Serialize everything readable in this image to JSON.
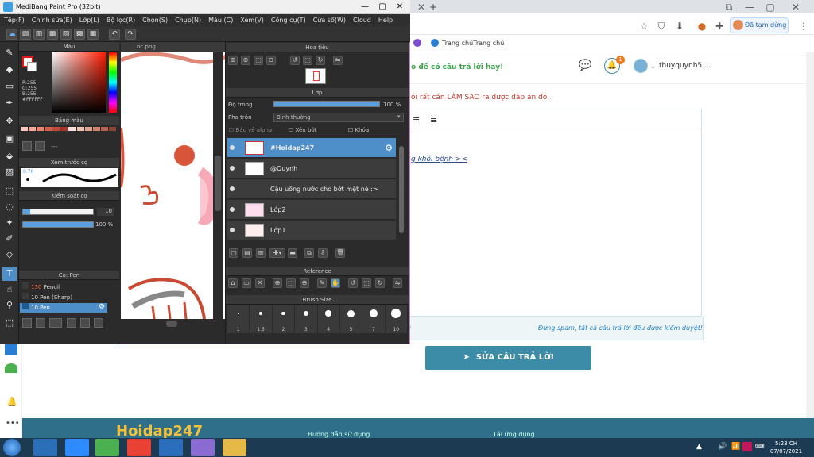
{
  "browser": {
    "bookmark": "Trang chủTrang chủ",
    "profile_label": "Đã tạm dừng",
    "login_prompt": "o để có câu trả lời hay!",
    "user_name": "thuyquynh5 ...",
    "notif_count": "1",
    "question_text": "ỏi rất cần LÀM SAO ra được đáp án đó.",
    "editor_text": "g khỏi bệnh ><",
    "warning": "Đừng spam, tất cả câu trả lời đều được kiểm duyệt!",
    "submit_label": "SỬA CÂU TRẢ LỜI",
    "footer_logo": "Hoidap247",
    "footer_link1": "Hướng dẫn sử dụng",
    "footer_link2": "Tải ứng dụng"
  },
  "app": {
    "title": "MediBang Paint Pro (32bit)",
    "menu": [
      "Tệp(F)",
      "Chỉnh sửa(E)",
      "Lớp(L)",
      "Bộ lọc(R)",
      "Chọn(S)",
      "Chụp(N)",
      "Màu (C)",
      "Xem(V)",
      "Công cụ(T)",
      "Cửa sổ(W)",
      "Cloud",
      "Help"
    ],
    "canvas_tab": "nc.png",
    "color_panel": {
      "title": "Màu",
      "r": "R:255",
      "g": "G:255",
      "b": "B:255",
      "hex": "#FFFFFF",
      "fg_color": "#ffffff",
      "bg_color": "#ffffff"
    },
    "palette_panel": {
      "title": "Bảng màu",
      "swatches": [
        "#f7c9c1",
        "#f2a899",
        "#e88572",
        "#d85f4c",
        "#c9463a",
        "#a83326",
        "#f7e0d8",
        "#eec3b6",
        "#e0a493",
        "#cf8470",
        "#b6614f",
        "#8e4538"
      ]
    },
    "brush_preview": {
      "title": "Xem trước cọ",
      "size_label": "0.70"
    },
    "brush_control": {
      "title": "Kiểm soát cọ",
      "size_value": "10",
      "opacity_value": "100 %",
      "size_fraction": 0.1,
      "opacity_fraction": 1.0
    },
    "brush_list": {
      "title": "Cọ: Pen",
      "items": [
        {
          "size": "130",
          "name": "Pencil",
          "swatch": "#3a3a3a"
        },
        {
          "size": "10",
          "name": "Pen (Sharp)",
          "swatch": "#3a3a3a"
        },
        {
          "size": "10",
          "name": "Pen",
          "swatch": "#1e5b8c"
        }
      ]
    },
    "navigator": {
      "title": "Hoa tiêu"
    },
    "layers": {
      "title": "Lớp",
      "opacity_label": "Độ trong",
      "opacity_value": "100 %",
      "opacity_fraction": 1.0,
      "blend_label": "Pha trộn",
      "blend_value": "Bình thường",
      "protect_alpha": "Bảo vệ alpha",
      "clip": "Xén bớt",
      "lock": "Khóa",
      "items": [
        {
          "name": "#Hoidap247"
        },
        {
          "name": "@Quynh"
        },
        {
          "name": "Cậu uống nước cho bớt mệt nè :>"
        },
        {
          "name": "Lớp2"
        },
        {
          "name": "Lớp1"
        }
      ]
    },
    "reference": {
      "title": "Reference"
    },
    "brush_size": {
      "title": "Brush Size",
      "sizes": [
        "1",
        "1.5",
        "2",
        "3",
        "4",
        "5",
        "7",
        "10"
      ]
    }
  },
  "taskbar": {
    "time": "5:23 CH",
    "date": "07/07/2021",
    "accent": "#1c3a52"
  }
}
